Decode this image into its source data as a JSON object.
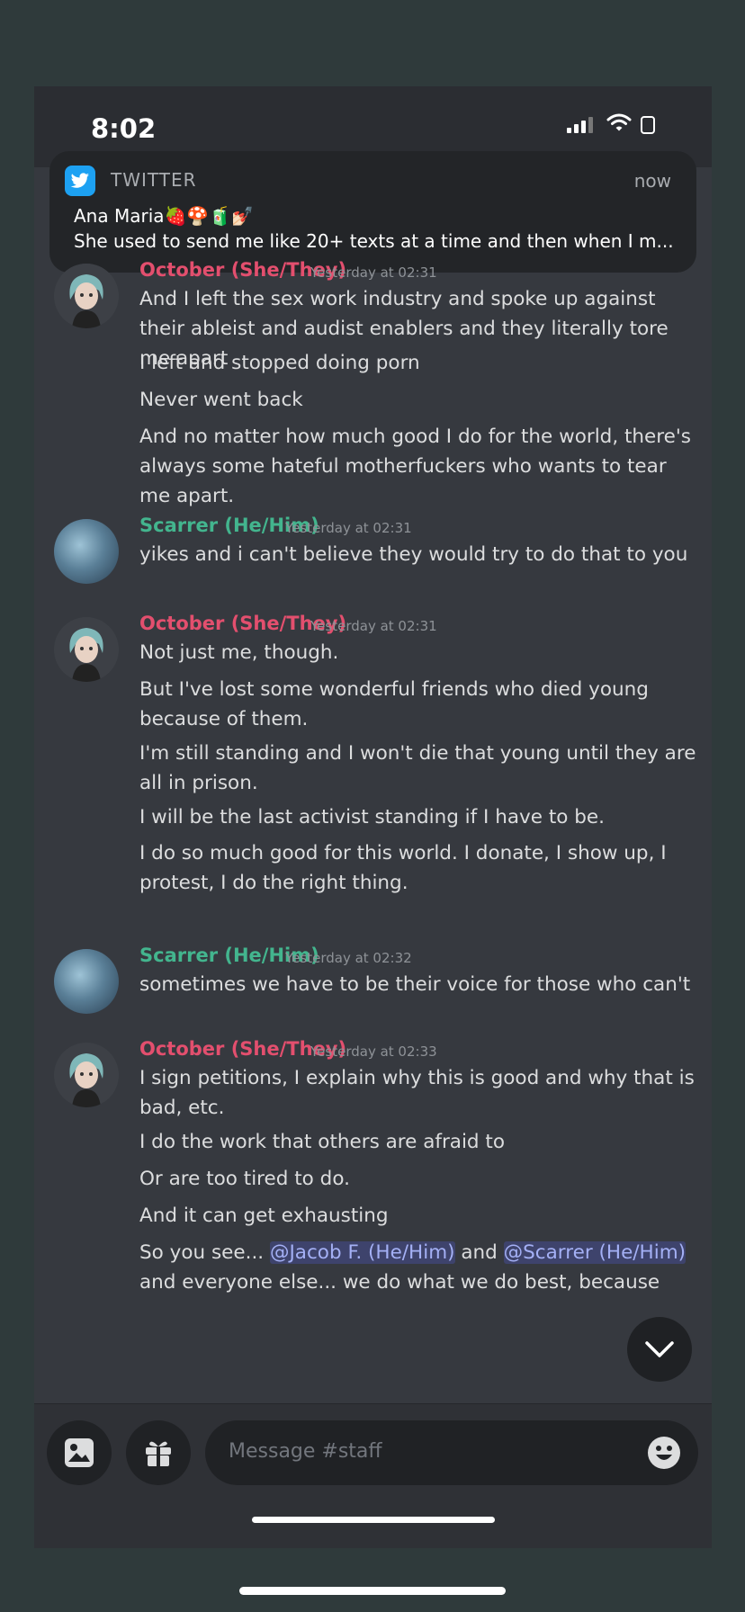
{
  "status": {
    "time": "8:02"
  },
  "notification": {
    "app": "TWITTER",
    "time": "now",
    "title": "Ana Maria🍓🍄🧃💅🏻",
    "body": "She used to send me like 20+ texts at a time and then when I m..."
  },
  "messages": [
    {
      "author": "October (She/They)",
      "timestamp": "Yesterday at 02:31",
      "lines": [
        "And I left the sex work industry and spoke up against their ableist and audist enablers and they literally tore me apart",
        "I left and stopped doing porn",
        "Never went back",
        "And no matter how much good I do for the world, there's always some hateful motherfuckers who wants to tear me apart."
      ]
    },
    {
      "author": "Scarrer (He/Him)",
      "timestamp": "Yesterday at 02:31",
      "lines": [
        "yikes and i can't believe they would try to do that to you"
      ]
    },
    {
      "author": "October (She/They)",
      "timestamp": "Yesterday at 02:31",
      "lines": [
        "Not just me, though.",
        "But I've lost some wonderful friends who died young because of them.",
        "I'm still standing and I won't die that young until they are all in prison.",
        "I will be the last activist standing if I have to be.",
        "I do so much good for this world. I donate, I show up, I protest, I do the right thing."
      ]
    },
    {
      "author": "Scarrer (He/Him)",
      "timestamp": "Yesterday at 02:32",
      "lines": [
        "sometimes we have to be their voice for those who can't"
      ]
    },
    {
      "author": "October (She/They)",
      "timestamp": "Yesterday at 02:33",
      "lines": [
        "I sign petitions, I explain why this is good and why that is bad, etc.",
        "I do the work that others are afraid to",
        "Or are too tired to do.",
        "And it can get exhausting"
      ],
      "last_line": {
        "prefix": "So you see... ",
        "mention1": "@Jacob F. (He/Him)",
        "middle": " and ",
        "mention2": "@Scarrer (He/Him)",
        "suffix": " and everyone else... we do what we do best, because"
      }
    }
  ],
  "composer": {
    "placeholder": "Message #staff"
  },
  "colors": {
    "october": "#e34f6e",
    "scarrer": "#43b58e",
    "background": "#36393f"
  }
}
